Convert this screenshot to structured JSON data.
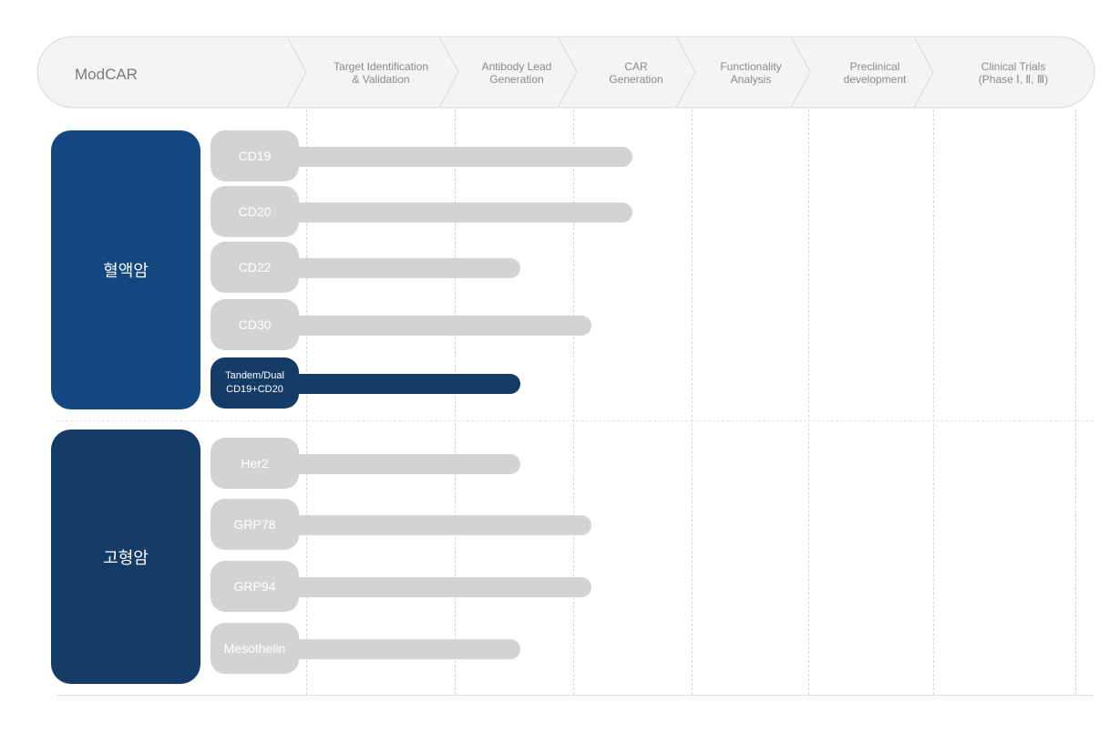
{
  "header": {
    "brand": "ModCAR",
    "stages": [
      "Target Identification\n& Validation",
      "Antibody Lead\nGeneration",
      "CAR\nGeneration",
      "Functionality\nAnalysis",
      "Preclinical\ndevelopment",
      "Clinical Trials\n(Phase Ⅰ, Ⅱ, Ⅲ)"
    ]
  },
  "colors": {
    "blood_group": "#134780",
    "solid_group": "#143c67",
    "bar_default": "#d3d3d3",
    "bar_highlight": "#143c67",
    "header_fill": "#f4f4f4",
    "header_stroke": "#d8d8d8",
    "grid": "#d6d6d6"
  },
  "chart_data": {
    "type": "bar",
    "orientation": "horizontal",
    "value_meaning": "furthest pipeline stage reached (1 = Target Identification & Validation ... 6 = Clinical Trials); fractional values = partway into the stage",
    "groups": [
      {
        "label": "혈액암",
        "color": "#134780",
        "targets": [
          {
            "label": "CD19",
            "value": 3.5,
            "highlight": false
          },
          {
            "label": "CD20",
            "value": 3.5,
            "highlight": false
          },
          {
            "label": "CD22",
            "value": 2.55,
            "highlight": false
          },
          {
            "label": "CD30",
            "value": 3.15,
            "highlight": false
          },
          {
            "label": "Tandem/Dual\nCD19+CD20",
            "value": 2.55,
            "highlight": true
          }
        ]
      },
      {
        "label": "고형암",
        "color": "#143c67",
        "targets": [
          {
            "label": "Her2",
            "value": 2.55,
            "highlight": false
          },
          {
            "label": "GRP78",
            "value": 3.15,
            "highlight": false
          },
          {
            "label": "GRP94",
            "value": 3.15,
            "highlight": false
          },
          {
            "label": "Mesothelin",
            "value": 2.55,
            "highlight": false
          }
        ]
      }
    ]
  }
}
